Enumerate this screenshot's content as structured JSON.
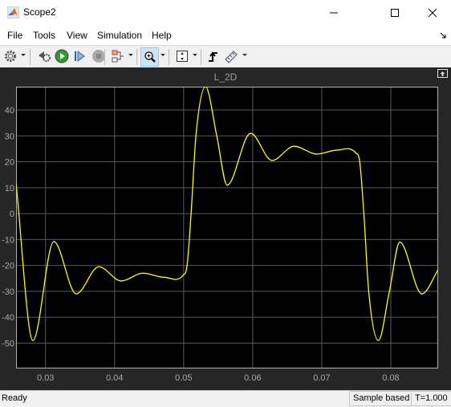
{
  "window": {
    "title": "Scope2",
    "minimize_icon": "minimize-icon",
    "maximize_icon": "maximize-icon",
    "close_icon": "close-icon"
  },
  "menu": {
    "items": [
      "File",
      "Tools",
      "View",
      "Simulation",
      "Help"
    ]
  },
  "toolbar": {
    "icons": [
      "gear-icon",
      "step-back-icon",
      "run-icon",
      "step-forward-icon",
      "stop-icon",
      "signal-selector-icon",
      "zoom-in-icon",
      "scale-axes-icon",
      "triggers-icon",
      "measurements-icon"
    ],
    "active": "zoom-in-icon"
  },
  "status": {
    "text": "Ready",
    "mode": "Sample based",
    "time": "T=1.000"
  },
  "colors": {
    "background": "#000000",
    "panel": "#262626",
    "grid": "#5a5a5a",
    "trace": "#ffff00",
    "ticks": "#a8a8a8"
  },
  "chart_data": {
    "type": "line",
    "title": "L_2D",
    "xlabel": "",
    "ylabel": "",
    "xlim": [
      0.02573,
      0.08686
    ],
    "ylim": [
      -59.8,
      49.0
    ],
    "grid": true,
    "xticks": [
      "0.03",
      "0.04",
      "0.05",
      "0.06",
      "0.07",
      "0.08"
    ],
    "yticks": [
      "40",
      "30",
      "20",
      "10",
      "0",
      "-10",
      "-20",
      "-30",
      "-40",
      "-50"
    ],
    "series": [
      {
        "color": "#ffff00",
        "x": [
          0.02573,
          0.02817,
          0.0312,
          0.03445,
          0.03771,
          0.04097,
          0.0441,
          0.04724,
          0.04992,
          0.0505,
          0.05108,
          0.05178,
          0.05317,
          0.0548,
          0.0563,
          0.0597,
          0.0628,
          0.066,
          0.0693,
          0.0722,
          0.0749,
          0.0755,
          0.0761,
          0.0768,
          0.0782,
          0.0798,
          0.0813,
          0.0845,
          0.0869
        ],
        "y": [
          11.6,
          -49,
          -10.8,
          -31,
          -20.5,
          -26,
          -23,
          -24.6,
          -23.8,
          -20,
          0,
          30,
          49,
          30,
          11,
          31,
          20.5,
          26,
          23,
          24.5,
          23.5,
          20,
          0,
          -30,
          -49,
          -30,
          -11,
          -31,
          -21.5
        ]
      }
    ]
  }
}
